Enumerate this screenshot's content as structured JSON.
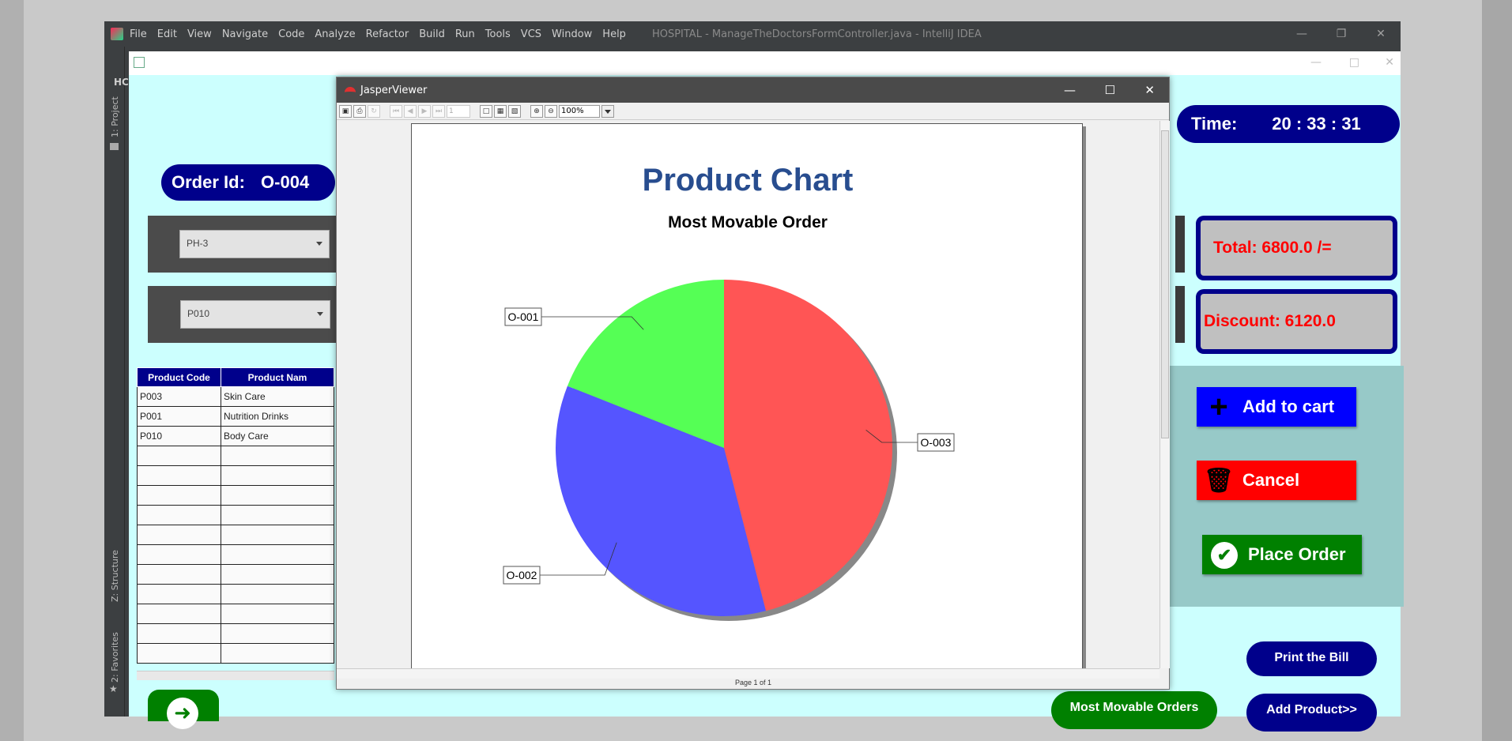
{
  "ide": {
    "menu": [
      "File",
      "Edit",
      "View",
      "Navigate",
      "Code",
      "Analyze",
      "Refactor",
      "Build",
      "Run",
      "Tools",
      "VCS",
      "Window",
      "Help"
    ],
    "title": "HOSPITAL - ManageTheDoctorsFormController.java - IntelliJ IDEA",
    "tool_project": "1: Project",
    "tool_structure": "Z: Structure",
    "tool_favorites": "2: Favorites",
    "hc_label": "HC"
  },
  "form": {
    "order_label": "Order Id:",
    "order_value": "O-004",
    "time_label": "Time:",
    "time_value": "20 : 33 : 31",
    "combo1_value": "PH-3",
    "combo2_value": "P010",
    "table": {
      "headers": [
        "Product Code",
        "Product Nam"
      ],
      "rows": [
        [
          "P003",
          "Skin Care"
        ],
        [
          "P001",
          "Nutrition Drinks"
        ],
        [
          "P010",
          "Body Care"
        ]
      ]
    },
    "total_text": "Total:   6800.0 /=",
    "discount_text": "Discount: 6120.0",
    "add_to_cart": "Add to cart",
    "cancel": "Cancel",
    "place_order": "Place Order",
    "print_bill": "Print the Bill",
    "most_movable": "Most Movable Orders",
    "add_product": "Add Product>>",
    "colors": {
      "navy": "#00008b",
      "red": "#ff0000",
      "blue_btn": "#0000ff",
      "green_btn": "#008000"
    }
  },
  "viewer": {
    "title": "JasperViewer",
    "zoom": "100%",
    "page_input": "1",
    "status": "Page 1 of 1"
  },
  "chart_data": {
    "type": "pie",
    "title": "Product Chart",
    "subtitle": "Most  Movable Order",
    "labels": [
      "O-003",
      "O-002",
      "O-001"
    ],
    "values": [
      46,
      35,
      19
    ],
    "colors": [
      "#ff5555",
      "#5555ff",
      "#55ff55"
    ]
  }
}
